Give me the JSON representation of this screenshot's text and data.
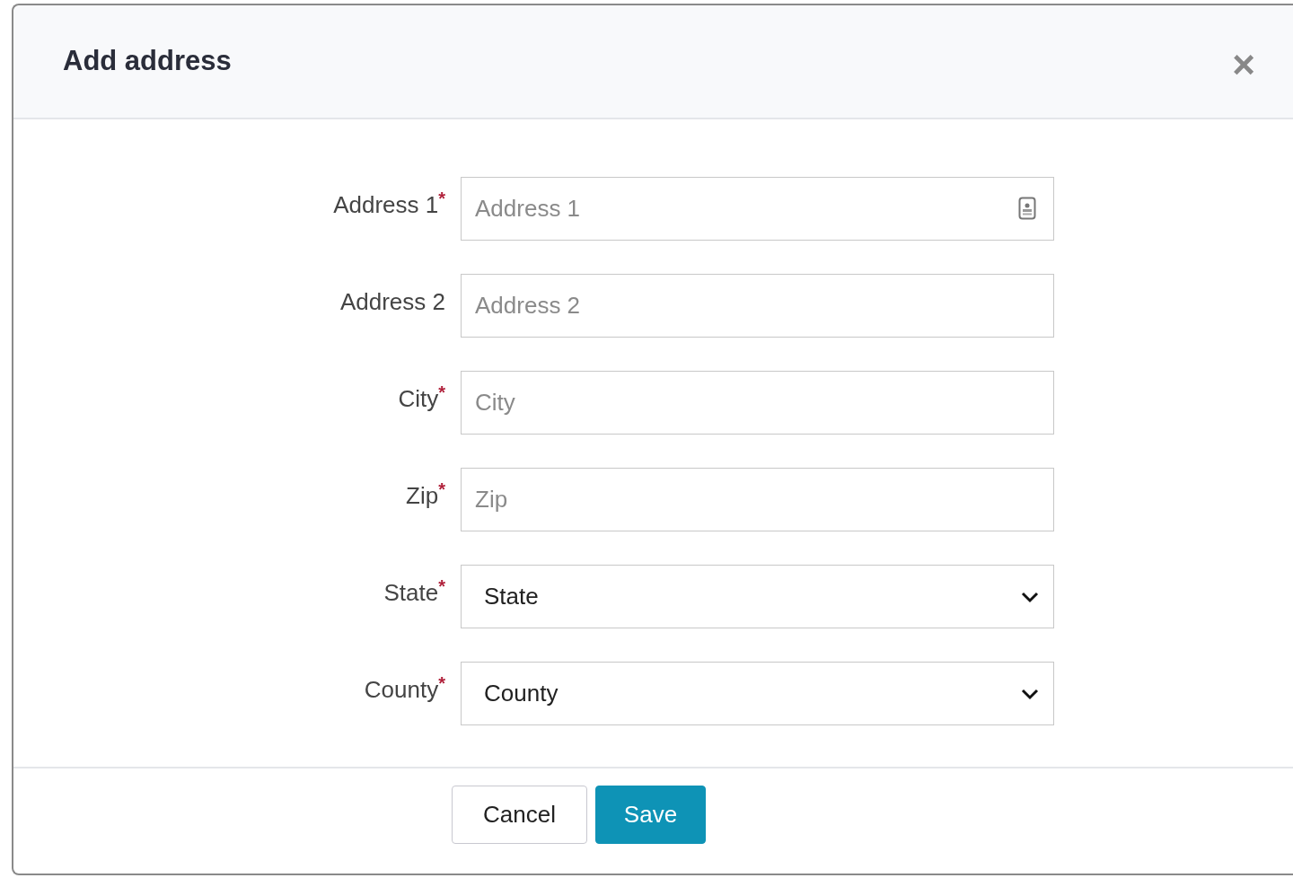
{
  "dialog": {
    "title": "Add address",
    "close": "×"
  },
  "required_mark": "*",
  "fields": [
    {
      "kind": "input",
      "label": "Address 1",
      "required": true,
      "placeholder": "Address 1",
      "contact_icon": true
    },
    {
      "kind": "input",
      "label": "Address 2",
      "required": false,
      "placeholder": "Address 2",
      "contact_icon": false
    },
    {
      "kind": "input",
      "label": "City",
      "required": true,
      "placeholder": "City",
      "contact_icon": false
    },
    {
      "kind": "input",
      "label": "Zip",
      "required": true,
      "placeholder": "Zip",
      "contact_icon": false
    },
    {
      "kind": "select",
      "label": "State",
      "required": true,
      "value": "State"
    },
    {
      "kind": "select",
      "label": "County",
      "required": true,
      "value": "County"
    }
  ],
  "buttons": [
    {
      "kind": "secondary",
      "label": "Cancel"
    },
    {
      "kind": "primary",
      "label": "Save"
    }
  ]
}
